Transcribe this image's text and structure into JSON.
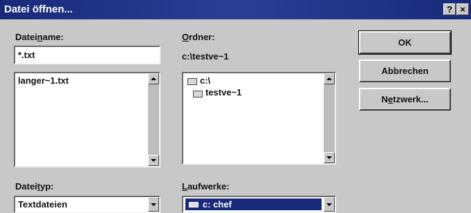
{
  "window": {
    "title": "Datei öffnen...",
    "help_btn": "?",
    "close_btn": "×"
  },
  "filename": {
    "label_pre": "Datei",
    "label_ul": "n",
    "label_post": "ame:",
    "value": "*.txt",
    "files": [
      "langer~1.txt"
    ]
  },
  "folders": {
    "label_ul": "O",
    "label_post": "rdner:",
    "path": "c:\\testve~1",
    "items": [
      "c:\\",
      "testve~1"
    ]
  },
  "filetype": {
    "label_pre": "Datei",
    "label_ul": "t",
    "label_post": "yp:",
    "selected": "Textdateien"
  },
  "drives": {
    "label_ul": "L",
    "label_post": "aufwerke:",
    "selected": "c: chef"
  },
  "buttons": {
    "ok": "OK",
    "cancel": "Abbrechen",
    "network_pre": "N",
    "network_ul": "e",
    "network_post": "tzwerk..."
  }
}
